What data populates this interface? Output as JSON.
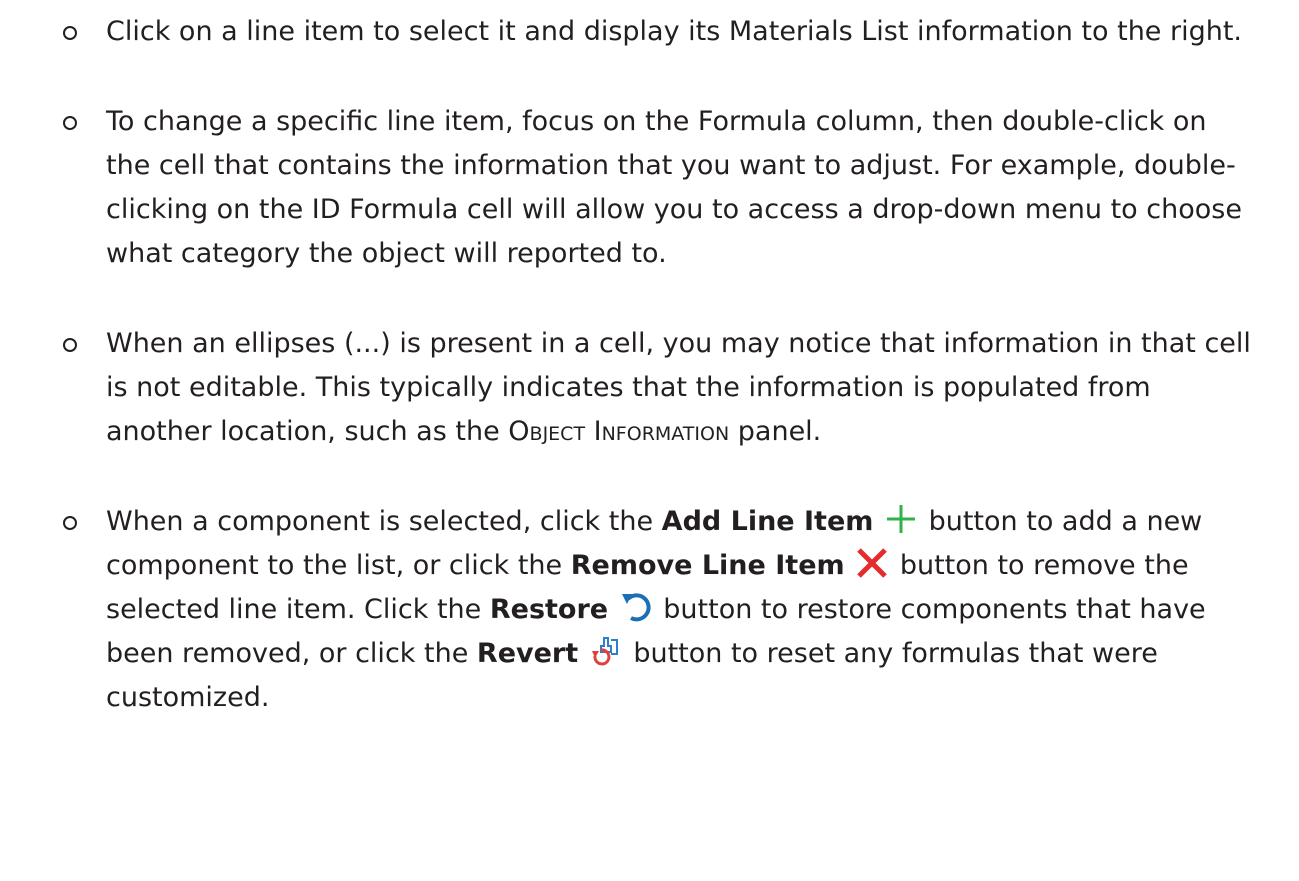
{
  "bullets": [
    {
      "text": "Click on a line item to select it and display its Materials List information to the right."
    },
    {
      "text": "To change a specific line item, focus on the Formula column, then double-click on the cell that contains the information that you want to adjust. For example, double-clicking on the ID Formula cell will allow you to access a drop-down menu to choose what category the object will reported to."
    },
    {
      "text_before": "When an ellipses (...) is present in a cell, you may notice that information in that cell is not editable. This typically indicates that the information is populated from another location, such as the ",
      "panel_name": "Object Information",
      "text_after": " panel."
    },
    {
      "part1": "When a component is selected, click the ",
      "add_label": "Add Line Item",
      "part2": " button to add a new component to the list, or click the ",
      "remove_label": "Remove Line Item",
      "part3": " button to remove the selected line item. Click the ",
      "restore_label": "Restore",
      "part4": " button to restore components that have been removed, or click the ",
      "revert_label": "Revert",
      "part5": " button to reset any formulas that were customized."
    }
  ],
  "icons": {
    "add": "plus-icon",
    "remove": "x-icon",
    "restore": "restore-icon",
    "revert": "revert-icon"
  },
  "colors": {
    "add_icon": "#2db34a",
    "remove_icon": "#e52b2b",
    "restore_icon": "#1a6fb5",
    "revert_icon_accent": "#e04040",
    "revert_icon_body": "#2d7fc8"
  }
}
